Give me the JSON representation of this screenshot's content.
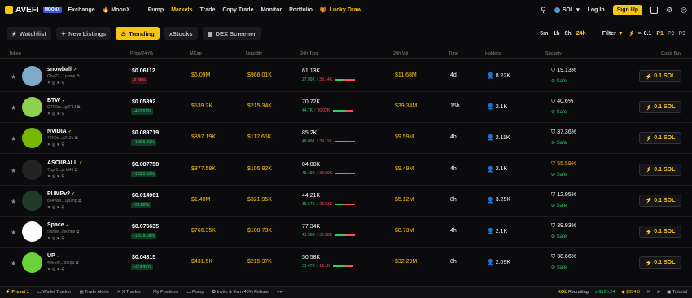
{
  "brand": {
    "name": "AVEFI",
    "badge": "MOONX"
  },
  "nav": {
    "exchange": "Exchange",
    "moonx": "MoonX",
    "pump": "Pump",
    "markets": "Markets",
    "trade": "Trade",
    "copy_trade": "Copy Trade",
    "monitor": "Monitor",
    "portfolio": "Portfolio",
    "lucky_draw": "Lucky Draw"
  },
  "top_right": {
    "chain": "SOL",
    "login": "Log In",
    "signup": "Sign Up"
  },
  "filters": {
    "watchlist": "Watchlist",
    "new_listings": "New Listings",
    "trending": "Trending",
    "xstocks": "xStocks",
    "dex_screener": "DEX Screener",
    "timeframes": [
      "5m",
      "1h",
      "6h",
      "24h"
    ],
    "filter": "Filter",
    "amount": "0.1",
    "presets": [
      "P1",
      "P2",
      "P3"
    ]
  },
  "columns": {
    "token": "Token",
    "price": "Price/24h%",
    "mcap": "MCap",
    "liquidity": "Liquidity",
    "txns": "24h Txns",
    "vol": "24h Vol",
    "time": "Time",
    "holders": "Holders",
    "security": "Security",
    "quick_buy": "Quick Buy"
  },
  "rows": [
    {
      "name": "snowball",
      "addr": "Gbu72...1pump",
      "price": "$0.06112",
      "change": "-6.86%",
      "dir": "down",
      "mcap": "$6.09M",
      "liq": "$966.01K",
      "txns": "61.13K",
      "buys": "27.99K",
      "sells": "33.14K",
      "buy_frac": 0.46,
      "vol": "$11.68M",
      "time": "4d",
      "holders": "8.22K",
      "sec": "19.13%",
      "sec_warn": false,
      "safe": "Safe",
      "buy": "0.1 SOL",
      "avatar": "#7fa8c9"
    },
    {
      "name": "BTW",
      "addr": "G7C9m...g2F1J",
      "price": "$0.05392",
      "change": "+492.61%",
      "dir": "up",
      "mcap": "$539.2K",
      "liq": "$215.34K",
      "txns": "70.72K",
      "buys": "44.7K",
      "sells": "26.02K",
      "buy_frac": 0.63,
      "vol": "$39.34M",
      "time": "15h",
      "holders": "2.1K",
      "sec": "40.6%",
      "sec_warn": false,
      "safe": "Safe",
      "buy": "0.1 SOL",
      "avatar": "#8fd14f"
    },
    {
      "name": "NVIDIA",
      "addr": "47K9s...d24Za",
      "price": "$0.089719",
      "change": "+1,860.31%",
      "dir": "up",
      "mcap": "$897.19K",
      "liq": "$112.66K",
      "txns": "85.2K",
      "buys": "46.09K",
      "sells": "39.11K",
      "buy_frac": 0.54,
      "vol": "$9.59M",
      "time": "4h",
      "holders": "2.11K",
      "sec": "37.36%",
      "sec_warn": false,
      "safe": "Safe",
      "buy": "0.1 SOL",
      "avatar": "#76b900"
    },
    {
      "name": "ASCIIBALL",
      "addr": "7cgv5...pHd49",
      "price": "$0.087758",
      "change": "+1,820.93%",
      "dir": "up",
      "mcap": "$877.58K",
      "liq": "$105.92K",
      "txns": "84.08K",
      "buys": "45.49K",
      "sells": "38.59K",
      "buy_frac": 0.54,
      "vol": "$9.49M",
      "time": "4h",
      "holders": "2.1K",
      "sec": "55.59%",
      "sec_warn": true,
      "safe": "Safe",
      "buy": "0.1 SOL",
      "avatar": "#222222"
    },
    {
      "name": "PUMPv2",
      "addr": "864WM...1pump",
      "price": "$0.014961",
      "change": "+38.88%",
      "dir": "up",
      "mcap": "$1.49M",
      "liq": "$321.95K",
      "txns": "44.21K",
      "buys": "15.67K",
      "sells": "28.53K",
      "buy_frac": 0.35,
      "vol": "$5.12M",
      "time": "8h",
      "holders": "3.25K",
      "sec": "12.95%",
      "sec_warn": false,
      "safe": "Safe",
      "buy": "0.1 SOL",
      "avatar": "#1f3b2a"
    },
    {
      "name": "Space",
      "addr": "5NrfW...mkmhs",
      "price": "$0.076635",
      "change": "+1,578.68%",
      "dir": "up",
      "mcap": "$766.35K",
      "liq": "$108.73K",
      "txns": "77.34K",
      "buys": "41.96K",
      "sells": "35.38K",
      "buy_frac": 0.54,
      "vol": "$8.73M",
      "time": "4h",
      "holders": "2.1K",
      "sec": "39.93%",
      "sec_warn": false,
      "safe": "Safe",
      "buy": "0.1 SOL",
      "avatar": "#ffffff"
    },
    {
      "name": "UP",
      "addr": "4yEEw...9b2qu",
      "price": "$0.04315",
      "change": "+379.49%",
      "dir": "up",
      "mcap": "$431.5K",
      "liq": "$215.37K",
      "txns": "50.58K",
      "buys": "31.47K",
      "sells": "19.1K",
      "buy_frac": 0.62,
      "vol": "$32.29M",
      "time": "8h",
      "holders": "2.09K",
      "sec": "38.66%",
      "sec_warn": false,
      "safe": "Safe",
      "buy": "0.1 SOL",
      "avatar": "#6bd13a"
    }
  ],
  "bottom": {
    "preset": "Preset 1",
    "wallet_tracker": "Wallet Tracker",
    "trade_alerts": "Trade Alerts",
    "x_tracker": "X Tracker",
    "my_positions": "My Positions",
    "pump": "Pump",
    "invite": "Invite & Earn 40% Rebate",
    "recruiting": "Recruiting",
    "kol": "KOL",
    "sol_price": "$125.24",
    "bnb_price": "$854.8",
    "tutorial": "Tutorial"
  }
}
